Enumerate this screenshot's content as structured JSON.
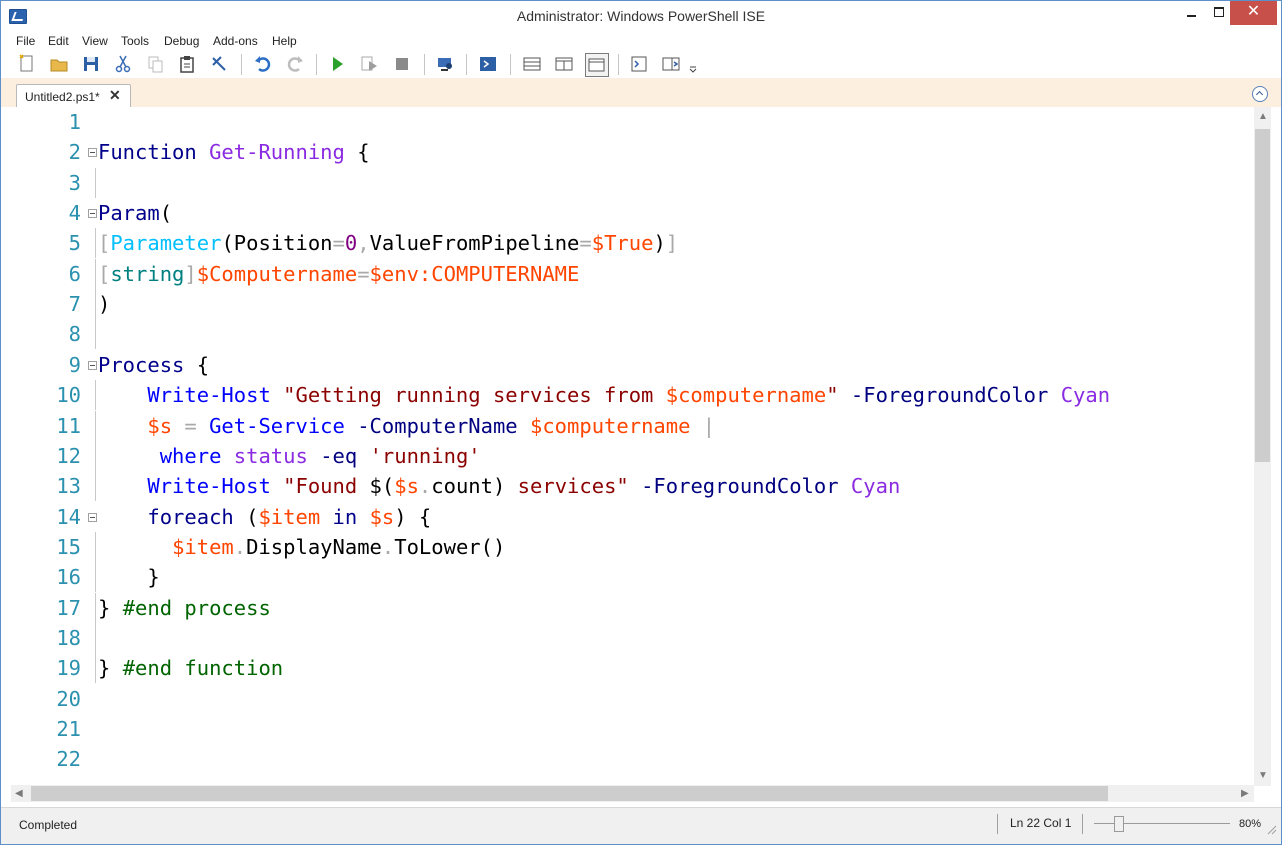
{
  "window": {
    "title": "Administrator: Windows PowerShell ISE",
    "close_glyph": "✕"
  },
  "menu": [
    "File",
    "Edit",
    "View",
    "Tools",
    "Debug",
    "Add-ons",
    "Help"
  ],
  "toolbar": {
    "buttons": [
      "new-script",
      "open",
      "save",
      "cut",
      "copy",
      "paste",
      "clear-console",
      "undo",
      "redo",
      "run-script",
      "run-selection",
      "stop",
      "new-remote-tab",
      "start-powershell",
      "show-script-pane-top",
      "show-script-pane-right",
      "show-script-pane-maximized",
      "show-command-window",
      "show-command-addon"
    ]
  },
  "tabs": [
    {
      "label": "Untitled2.ps1*",
      "close_glyph": "✕"
    }
  ],
  "editor": {
    "colors": {
      "keyword": "#00008b",
      "command": "#0000ff",
      "variable": "#ff4500",
      "string": "#8b0000",
      "comment": "#006400",
      "line_number": "#2b91af"
    },
    "lines": [
      {
        "n": "1",
        "tokens": []
      },
      {
        "n": "2",
        "tokens": [
          [
            "kw",
            "Function"
          ],
          [
            "txt",
            " "
          ],
          [
            "fn",
            "Get-Running"
          ],
          [
            "txt",
            " {"
          ]
        ]
      },
      {
        "n": "3",
        "tokens": []
      },
      {
        "n": "4",
        "tokens": [
          [
            "kw",
            "Param"
          ],
          [
            "txt",
            "("
          ]
        ]
      },
      {
        "n": "5",
        "tokens": [
          [
            "dim",
            "["
          ],
          [
            "attr",
            "Parameter"
          ],
          [
            "txt",
            "(Position"
          ],
          [
            "op",
            "="
          ],
          [
            "num",
            "0"
          ],
          [
            "op",
            ","
          ],
          [
            "txt",
            "ValueFromPipeline"
          ],
          [
            "op",
            "="
          ],
          [
            "var",
            "$True"
          ],
          [
            "txt",
            ")"
          ],
          [
            "dim",
            "]"
          ]
        ]
      },
      {
        "n": "6",
        "tokens": [
          [
            "dim",
            "["
          ],
          [
            "type",
            "string"
          ],
          [
            "dim",
            "]"
          ],
          [
            "var",
            "$Computername"
          ],
          [
            "op",
            "="
          ],
          [
            "var",
            "$env:COMPUTERNAME"
          ]
        ]
      },
      {
        "n": "7",
        "tokens": [
          [
            "txt",
            ")"
          ]
        ]
      },
      {
        "n": "8",
        "tokens": []
      },
      {
        "n": "9",
        "tokens": [
          [
            "kw",
            "Process"
          ],
          [
            "txt",
            " {"
          ]
        ]
      },
      {
        "n": "10",
        "tokens": [
          [
            "txt",
            "    "
          ],
          [
            "cmd",
            "Write-Host"
          ],
          [
            "txt",
            " "
          ],
          [
            "str",
            "\"Getting running services from "
          ],
          [
            "var",
            "$computername"
          ],
          [
            "str",
            "\""
          ],
          [
            "txt",
            " "
          ],
          [
            "param",
            "-ForegroundColor"
          ],
          [
            "txt",
            " "
          ],
          [
            "fn",
            "Cyan"
          ]
        ]
      },
      {
        "n": "11",
        "tokens": [
          [
            "txt",
            "    "
          ],
          [
            "var",
            "$s"
          ],
          [
            "txt",
            " "
          ],
          [
            "op",
            "="
          ],
          [
            "txt",
            " "
          ],
          [
            "cmd",
            "Get-Service"
          ],
          [
            "txt",
            " "
          ],
          [
            "param",
            "-ComputerName"
          ],
          [
            "txt",
            " "
          ],
          [
            "var",
            "$computername"
          ],
          [
            "txt",
            " "
          ],
          [
            "op",
            "|"
          ]
        ]
      },
      {
        "n": "12",
        "tokens": [
          [
            "txt",
            "     "
          ],
          [
            "cmd",
            "where"
          ],
          [
            "txt",
            " "
          ],
          [
            "fn",
            "status"
          ],
          [
            "txt",
            " "
          ],
          [
            "param",
            "-eq"
          ],
          [
            "txt",
            " "
          ],
          [
            "str",
            "'running'"
          ]
        ]
      },
      {
        "n": "13",
        "tokens": [
          [
            "txt",
            "    "
          ],
          [
            "cmd",
            "Write-Host"
          ],
          [
            "txt",
            " "
          ],
          [
            "str",
            "\"Found "
          ],
          [
            "txt",
            "$("
          ],
          [
            "var",
            "$s"
          ],
          [
            "op",
            "."
          ],
          [
            "txt",
            "count)"
          ],
          [
            "str",
            " services\""
          ],
          [
            "txt",
            " "
          ],
          [
            "param",
            "-ForegroundColor"
          ],
          [
            "txt",
            " "
          ],
          [
            "fn",
            "Cyan"
          ]
        ]
      },
      {
        "n": "14",
        "tokens": [
          [
            "txt",
            "    "
          ],
          [
            "kw",
            "foreach"
          ],
          [
            "txt",
            " ("
          ],
          [
            "var",
            "$item"
          ],
          [
            "txt",
            " "
          ],
          [
            "kw",
            "in"
          ],
          [
            "txt",
            " "
          ],
          [
            "var",
            "$s"
          ],
          [
            "txt",
            ") {"
          ]
        ]
      },
      {
        "n": "15",
        "tokens": [
          [
            "txt",
            "      "
          ],
          [
            "var",
            "$item"
          ],
          [
            "op",
            "."
          ],
          [
            "txt",
            "DisplayName"
          ],
          [
            "op",
            "."
          ],
          [
            "txt",
            "ToLower()"
          ]
        ]
      },
      {
        "n": "16",
        "tokens": [
          [
            "txt",
            "    }"
          ]
        ]
      },
      {
        "n": "17",
        "tokens": [
          [
            "txt",
            "} "
          ],
          [
            "cmt",
            "#end process"
          ]
        ]
      },
      {
        "n": "18",
        "tokens": []
      },
      {
        "n": "19",
        "tokens": [
          [
            "txt",
            "} "
          ],
          [
            "cmt",
            "#end function"
          ]
        ]
      },
      {
        "n": "20",
        "tokens": []
      },
      {
        "n": "21",
        "tokens": []
      },
      {
        "n": "22",
        "tokens": []
      }
    ]
  },
  "status": {
    "message": "Completed",
    "position": "Ln 22  Col 1",
    "zoom": "80%",
    "zoom_fraction": 0.15
  }
}
